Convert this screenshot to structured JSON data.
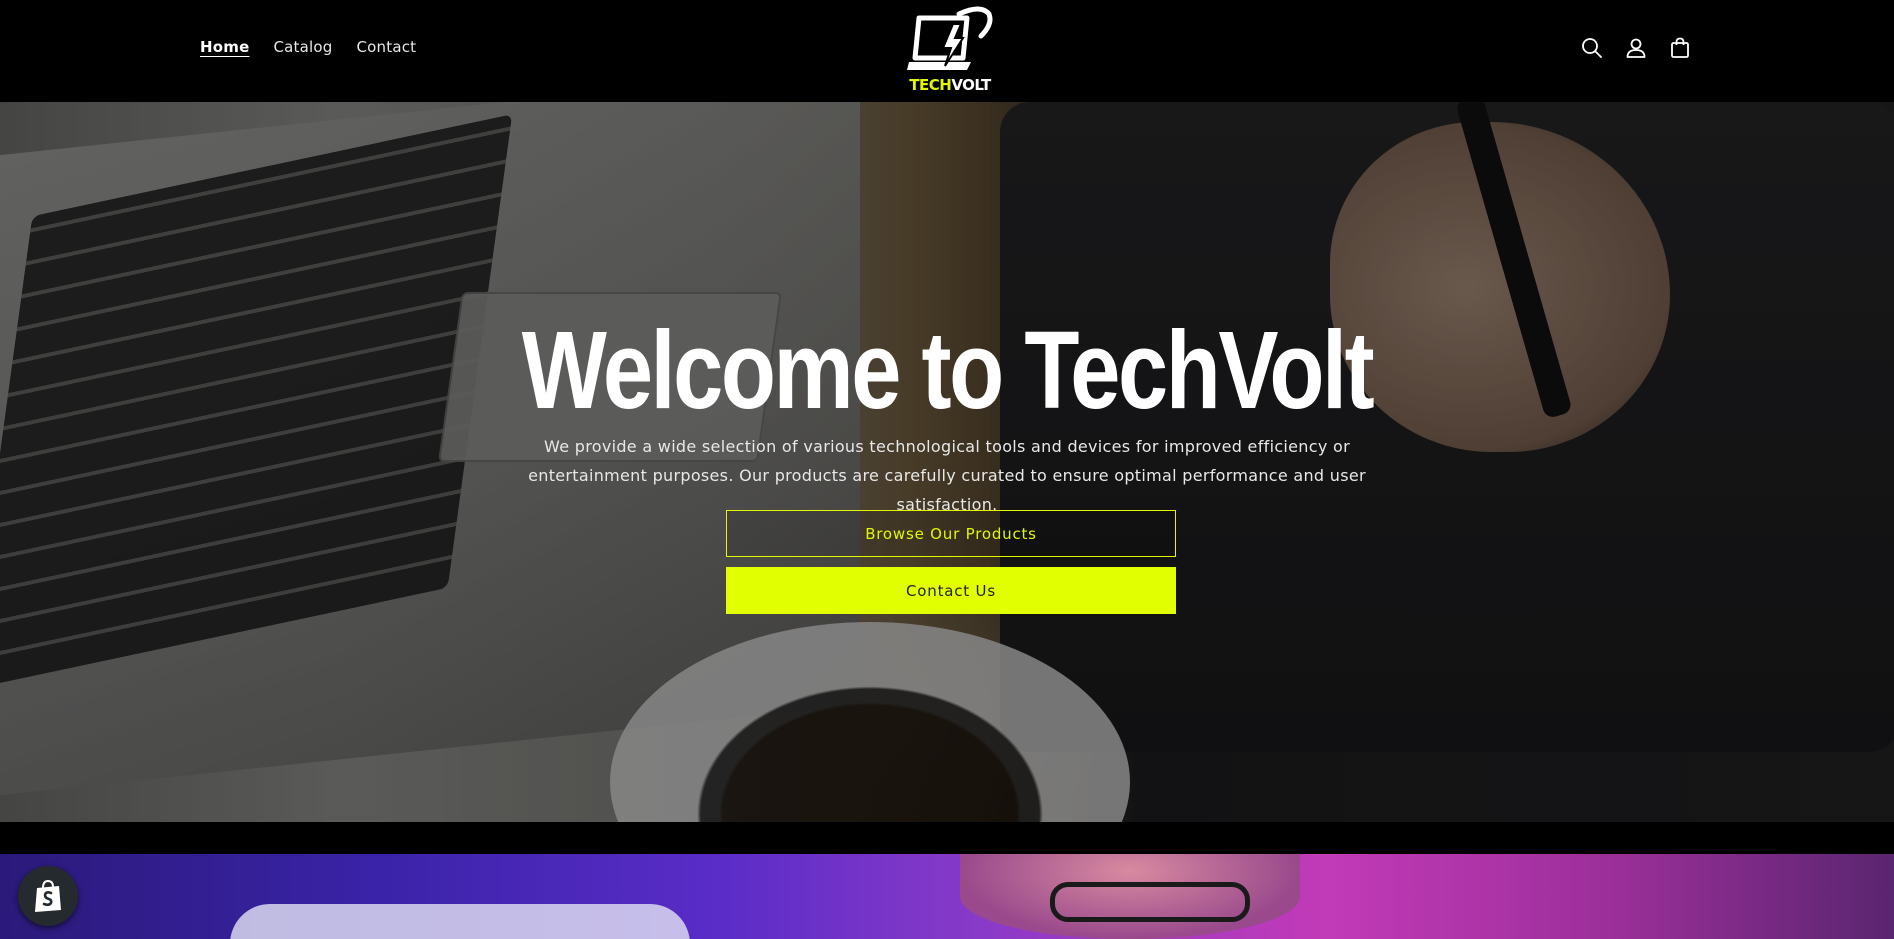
{
  "header": {
    "nav": [
      {
        "label": "Home"
      },
      {
        "label": "Catalog"
      },
      {
        "label": "Contact"
      }
    ],
    "logo": {
      "part1": "TECH",
      "part2": "VOLT"
    },
    "icons": [
      "search-icon",
      "account-icon",
      "cart-icon"
    ]
  },
  "hero": {
    "title": "Welcome to TechVolt",
    "description": "We provide a wide selection of various technological tools and devices for improved efficiency or entertainment purposes. Our products are carefully curated to ensure optimal performance and user satisfaction.",
    "primary_button": "Browse Our Products",
    "secondary_button": "Contact Us"
  },
  "colors": {
    "accent": "#e2ff00",
    "background": "#000000",
    "text": "#ffffff"
  },
  "badge": {
    "icon": "shopify-bag-icon"
  }
}
